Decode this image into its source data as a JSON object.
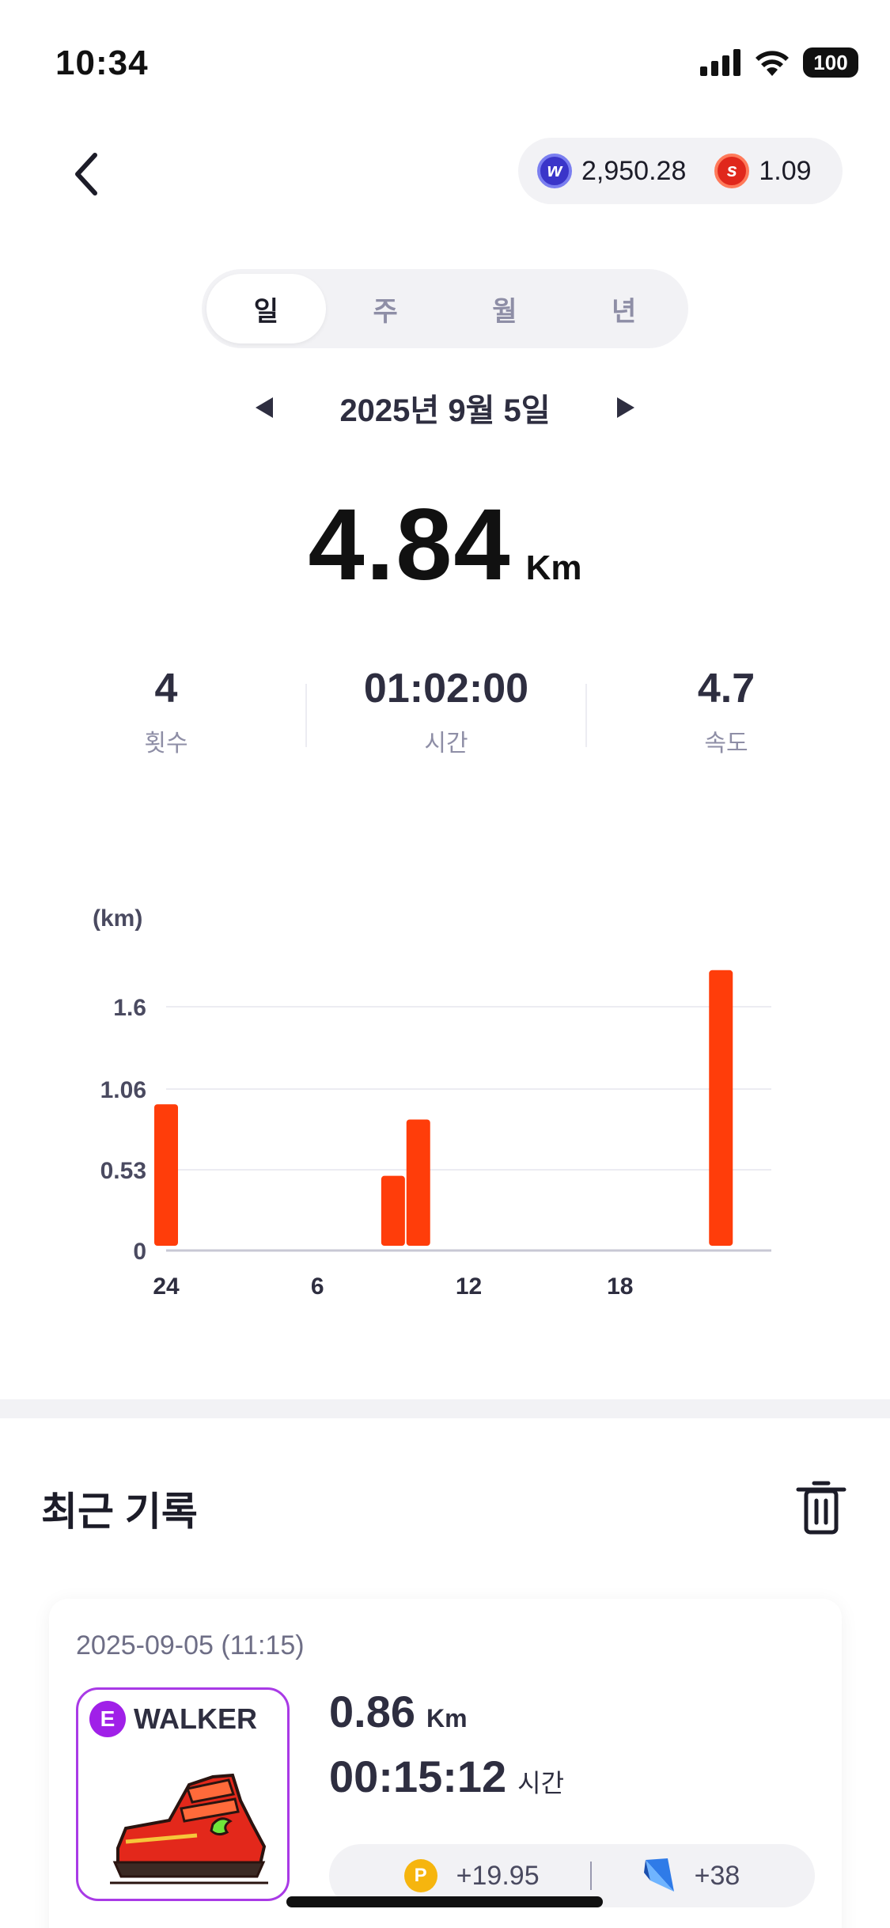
{
  "status": {
    "time": "10:34",
    "battery": "100"
  },
  "wallet": {
    "coin1": "2,950.28",
    "coin2": "1.09",
    "coin1_icon": "w-coin-icon",
    "coin2_icon": "s-coin-icon"
  },
  "tabs": [
    {
      "label": "일",
      "active": true
    },
    {
      "label": "주",
      "active": false
    },
    {
      "label": "월",
      "active": false
    },
    {
      "label": "년",
      "active": false
    }
  ],
  "date": "2025년 9월 5일",
  "summary": {
    "distance": "4.84",
    "unit": "Km"
  },
  "stats": [
    {
      "value": "4",
      "label": "횟수"
    },
    {
      "value": "01:02:00",
      "label": "시간"
    },
    {
      "value": "4.7",
      "label": "속도"
    }
  ],
  "chart_data": {
    "type": "bar",
    "ylabel": "(km)",
    "ylim": [
      0,
      1.6
    ],
    "yticks": [
      "1.6",
      "1.06",
      "0.53",
      "0"
    ],
    "yticks_values": [
      1.6,
      1.06,
      0.53,
      0
    ],
    "xticks": [
      "24",
      "6",
      "12",
      "18"
    ],
    "xticks_hours": [
      0,
      6,
      12,
      18
    ],
    "bars": [
      {
        "hour": 0,
        "value": 0.96
      },
      {
        "hour": 9,
        "value": 0.49
      },
      {
        "hour": 10,
        "value": 0.86
      },
      {
        "hour": 22,
        "value": 1.84
      }
    ],
    "color": "#ff3d0a",
    "grid": true
  },
  "recent": {
    "title": "최근 기록",
    "records": [
      {
        "date": "2025-09-05 (11:15)",
        "shoe_badge": "E",
        "shoe_type": "WALKER",
        "distance": "0.86",
        "distance_unit": "Km",
        "time": "00:15:12",
        "time_unit": "시간",
        "reward_points": "+19.95",
        "reward_gems": "+38"
      }
    ]
  }
}
